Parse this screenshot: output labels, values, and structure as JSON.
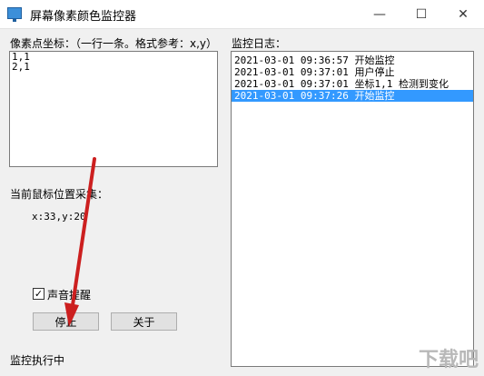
{
  "window": {
    "title": "屏幕像素颜色监控器",
    "minimize_glyph": "—",
    "maximize_glyph": "☐",
    "close_glyph": "✕"
  },
  "coords_panel": {
    "label": "像素点坐标：（一行一条。格式参考：x,y）",
    "lines": [
      "1,1",
      "2,1"
    ]
  },
  "log_panel": {
    "label": "监控日志：",
    "entries": [
      "2021-03-01 09:36:57 开始监控",
      "2021-03-01 09:37:01 用户停止",
      "2021-03-01 09:37:01 坐标1,1 检测到变化",
      "2021-03-01 09:37:26 开始监控"
    ],
    "selected_index": 3
  },
  "mouse": {
    "label": "当前鼠标位置采集：",
    "position": "x:33,y:20"
  },
  "sound": {
    "label": "声音提醒",
    "checked": true
  },
  "buttons": {
    "stop": "停止",
    "about": "关于"
  },
  "status": "监控执行中",
  "watermark": "下载吧",
  "colors": {
    "selection": "#3399ff",
    "arrow": "#cc1f1f",
    "window_bg": "#f0f0f0"
  }
}
